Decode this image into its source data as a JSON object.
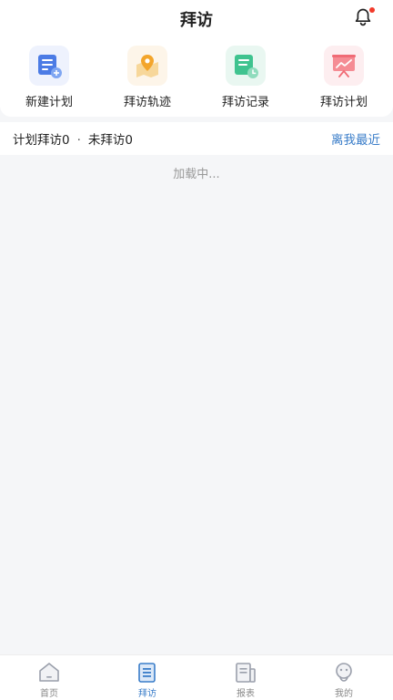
{
  "header": {
    "title": "拜访"
  },
  "quick_actions": [
    {
      "label": "新建计划",
      "icon": "new-plan-icon",
      "bg": "#eef2fd"
    },
    {
      "label": "拜访轨迹",
      "icon": "location-track-icon",
      "bg": "#fdf5e9"
    },
    {
      "label": "拜访记录",
      "icon": "visit-record-icon",
      "bg": "#e9f7f1"
    },
    {
      "label": "拜访计划",
      "icon": "visit-plan-chart-icon",
      "bg": "#fdeef0"
    }
  ],
  "stats": {
    "planned": "计划拜访0",
    "separator": "·",
    "unvisited": "未拜访0",
    "sort": "离我最近"
  },
  "loading_text": "加载中...",
  "tabbar": [
    {
      "label": "首页",
      "icon": "home-icon",
      "active": false
    },
    {
      "label": "拜访",
      "icon": "visit-icon",
      "active": true
    },
    {
      "label": "报表",
      "icon": "report-icon",
      "active": false
    },
    {
      "label": "我的",
      "icon": "profile-icon",
      "active": false
    }
  ],
  "colors": {
    "accent": "#3a7dc9",
    "notification": "#f23a2a"
  }
}
